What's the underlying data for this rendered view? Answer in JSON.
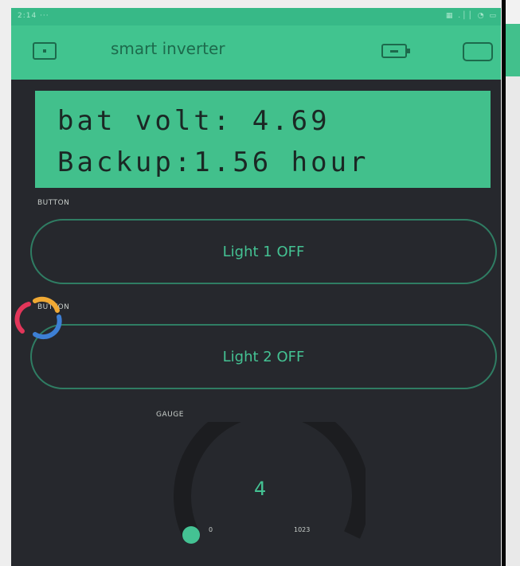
{
  "status_bar": {
    "time": "2:14 ···",
    "icons": "▦ .││ ◔ ▭"
  },
  "header": {
    "title": "smart inverter",
    "left_icon": "device-icon",
    "right_icons": [
      "battery-icon",
      "square-icon"
    ]
  },
  "lcd": {
    "line1": "bat volt: 4.69",
    "line2": "Backup:1.56 hour"
  },
  "buttons": [
    {
      "label": "BUTTON",
      "text": "Light 1 OFF"
    },
    {
      "label": "BUTTON",
      "text": "Light 2 OFF"
    }
  ],
  "gauge": {
    "label": "GAUGE",
    "value": "4",
    "min": "0",
    "max": "1023",
    "level": 0.004
  },
  "colors": {
    "accent": "#42c08c",
    "background": "#26282d",
    "text_dark": "#1b2724"
  }
}
